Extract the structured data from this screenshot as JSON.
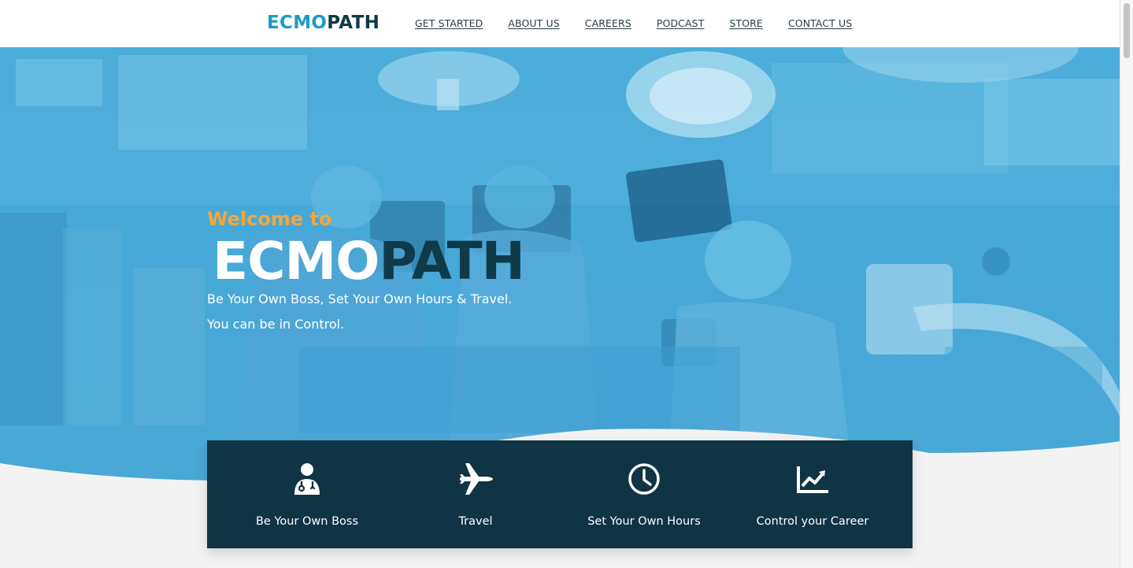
{
  "header": {
    "logo_part1": "ECMO",
    "logo_part2": "PATH",
    "nav": [
      {
        "label": "GET STARTED"
      },
      {
        "label": "ABOUT US"
      },
      {
        "label": "CAREERS"
      },
      {
        "label": "PODCAST"
      },
      {
        "label": "STORE"
      },
      {
        "label": "CONTACT US"
      }
    ]
  },
  "hero": {
    "welcome": "Welcome to",
    "brand_part1": "ECMO",
    "brand_part2": "PATH",
    "tagline1": "Be Your Own Boss, Set Your Own Hours & Travel.",
    "tagline2": "You can be in Control."
  },
  "features": [
    {
      "icon": "doctor-icon",
      "label": "Be Your Own Boss"
    },
    {
      "icon": "airplane-icon",
      "label": "Travel"
    },
    {
      "icon": "clock-icon",
      "label": "Set Your Own Hours"
    },
    {
      "icon": "chart-line-icon",
      "label": "Control your Career"
    }
  ],
  "colors": {
    "brand_light": "#1e9bc3",
    "brand_dark": "#0f3a4a",
    "accent": "#f4a73b",
    "panel": "#0f3444",
    "hero": "#46a9d8"
  }
}
